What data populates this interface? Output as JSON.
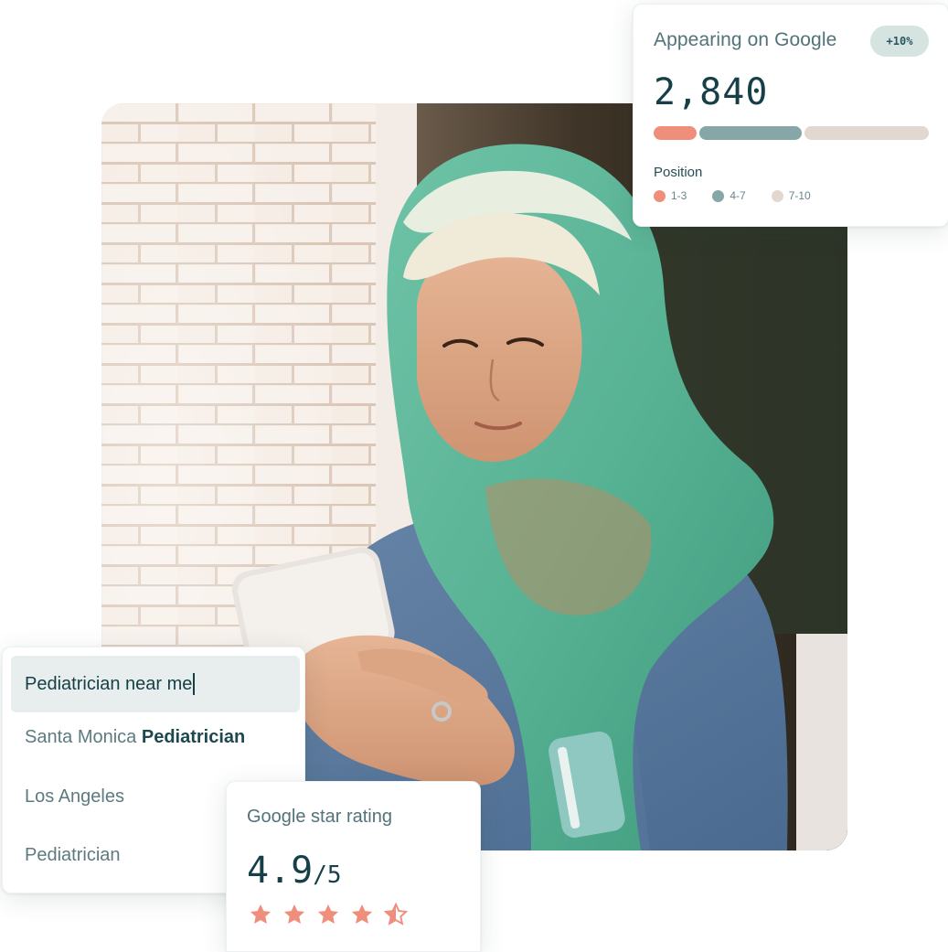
{
  "google_card": {
    "title": "Appearing on Google",
    "badge": "+10%",
    "value": "2,840",
    "position_label": "Position",
    "segments": [
      {
        "label": "1-3",
        "share": 0.16,
        "color": "#f08e7c"
      },
      {
        "label": "4-7",
        "share": 0.38,
        "color": "#86a6a8"
      },
      {
        "label": "7-10",
        "share": 0.46,
        "color": "#e3d8cf"
      }
    ]
  },
  "search_card": {
    "query": "Pediatrician near me",
    "suggestions": [
      {
        "prefix": "Santa Monica ",
        "bold": "Pediatrician"
      },
      {
        "prefix": "Los Angeles",
        "bold": ""
      },
      {
        "prefix": "Pediatrician",
        "bold": ""
      }
    ]
  },
  "rating_card": {
    "title": "Google star rating",
    "value": "4.9",
    "suffix": "/5",
    "rating": 4.5,
    "max": 5,
    "star_color": "#f08e7c"
  },
  "photo": {
    "description_icon": "woman-with-phone-photo"
  }
}
